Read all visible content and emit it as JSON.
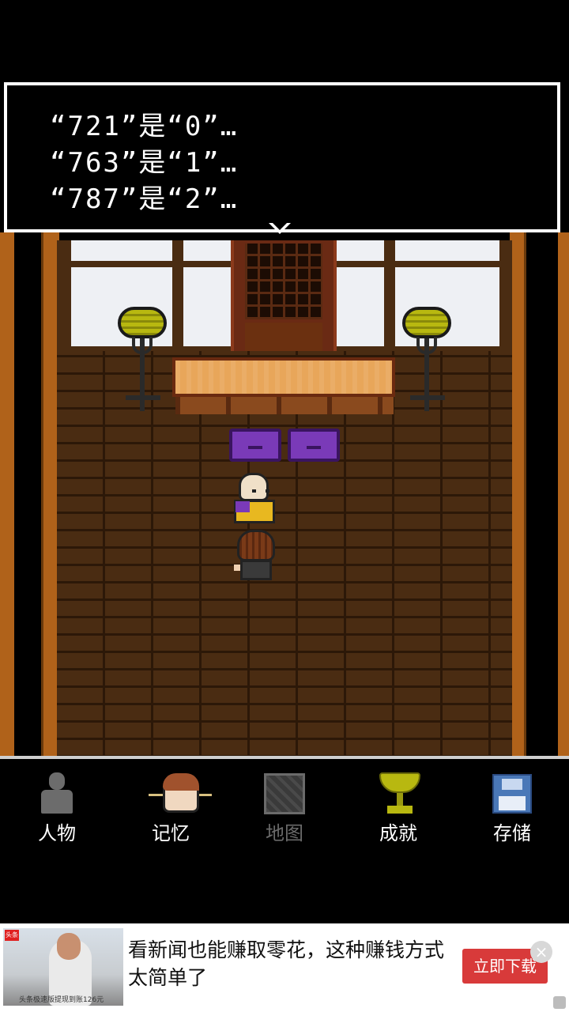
{
  "dialog": {
    "lines": [
      "“721”是“0”…",
      "“763”是“1”…",
      "“787”是“2”…"
    ]
  },
  "menu": {
    "items": [
      {
        "label": "人物",
        "icon": "person-icon",
        "enabled": true
      },
      {
        "label": "记忆",
        "icon": "memory-portrait-icon",
        "enabled": true
      },
      {
        "label": "地图",
        "icon": "map-icon",
        "enabled": false
      },
      {
        "label": "成就",
        "icon": "trophy-icon",
        "enabled": true
      },
      {
        "label": "存储",
        "icon": "floppy-disk-icon",
        "enabled": true
      }
    ]
  },
  "ad": {
    "text": "看新闻也能赚取零花，这种赚钱方式太简单了",
    "button": "立即下载",
    "close": "×",
    "thumb_tag": "头条",
    "thumb_caption": "头条极速版提现到账126元"
  },
  "colors": {
    "dialog_bg": "#000000",
    "dialog_border": "#ffffff",
    "pillar": "#b0621a",
    "floor": "#4a2c12",
    "cushion": "#7a3ab8",
    "ad_button": "#d83a3a",
    "menu_disabled": "#6a6a6a"
  }
}
